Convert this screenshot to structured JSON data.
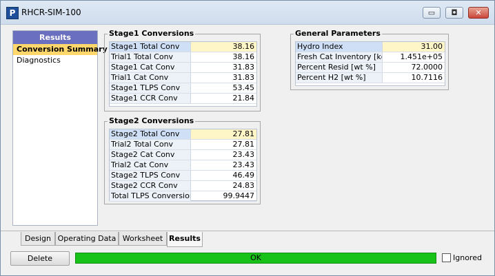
{
  "window": {
    "title": "RHCR-SIM-100",
    "app_icon_letter": "P"
  },
  "window_controls": {
    "minimize": "▭",
    "maximize": "◘",
    "close": "✕"
  },
  "nav": {
    "header": "Results",
    "items": [
      {
        "label": "Conversion Summary",
        "active": true
      },
      {
        "label": "Diagnostics",
        "active": false
      }
    ]
  },
  "stage1": {
    "title": "Stage1 Conversions",
    "rows": [
      {
        "label": "Stage1 Total Conv",
        "value": "38.16"
      },
      {
        "label": "Trial1 Total Conv",
        "value": "38.16"
      },
      {
        "label": "Stage1 Cat Conv",
        "value": "31.83"
      },
      {
        "label": "Trial1 Cat Conv",
        "value": "31.83"
      },
      {
        "label": "Stage1 TLPS Conv",
        "value": "53.45"
      },
      {
        "label": "Stage1 CCR Conv",
        "value": "21.84"
      }
    ]
  },
  "stage2": {
    "title": "Stage2 Conversions",
    "rows": [
      {
        "label": "Stage2 Total Conv",
        "value": "27.81"
      },
      {
        "label": "Trial2 Total Conv",
        "value": "27.81"
      },
      {
        "label": "Stage2 Cat Conv",
        "value": "23.43"
      },
      {
        "label": "Trial2 Cat Conv",
        "value": "23.43"
      },
      {
        "label": "Stage2 TLPS Conv",
        "value": "46.49"
      },
      {
        "label": "Stage2 CCR Conv",
        "value": "24.83"
      },
      {
        "label": "Total TLPS Conversion",
        "value": "99.9447"
      }
    ]
  },
  "general": {
    "title": "General Parameters",
    "rows": [
      {
        "label": "Hydro Index",
        "value": "31.00"
      },
      {
        "label": "Fresh Cat Inventory [kg]",
        "value": "1.451e+05"
      },
      {
        "label": "Percent Resid [wt %]",
        "value": "72.0000"
      },
      {
        "label": "Percent H2 [wt %]",
        "value": "10.7116"
      }
    ]
  },
  "tabs": [
    {
      "label": "Design",
      "active": false
    },
    {
      "label": "Operating Data",
      "active": false
    },
    {
      "label": "Worksheet",
      "active": false
    },
    {
      "label": "Results",
      "active": true
    }
  ],
  "footer": {
    "delete_label": "Delete",
    "status_text": "OK",
    "ignored_label": "Ignored",
    "ignored_checked": false
  },
  "colors": {
    "status_ok": "#19c219",
    "nav_header": "#6b6fbf",
    "nav_active": "#ffd76b",
    "selected_value": "#fff6c8"
  }
}
